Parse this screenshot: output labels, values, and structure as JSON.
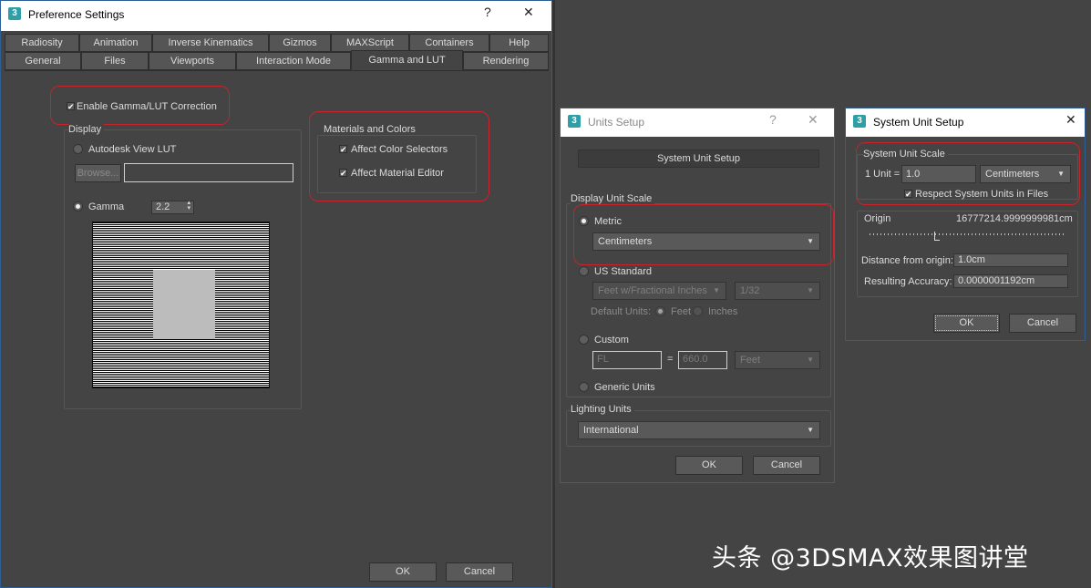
{
  "pref": {
    "title": "Preference Settings",
    "help_btn": "?",
    "close_btn": "✕",
    "logo": "3",
    "tabs_row1": [
      "Radiosity",
      "Animation",
      "Inverse Kinematics",
      "Gizmos",
      "MAXScript",
      "Containers",
      "Help"
    ],
    "tabs_row2": [
      "General",
      "Files",
      "Viewports",
      "Interaction Mode",
      "Gamma and LUT",
      "Rendering"
    ],
    "active_tab": "Gamma and LUT",
    "enable_gamma": "Enable Gamma/LUT Correction",
    "display_group": "Display",
    "autodesk_lut": "Autodesk View LUT",
    "browse_btn": "Browse...",
    "gamma_label": "Gamma",
    "gamma_value": "2.2",
    "materials_group": "Materials and Colors",
    "affect_color": "Affect Color Selectors",
    "affect_material": "Affect Material Editor",
    "ok": "OK",
    "cancel": "Cancel"
  },
  "units": {
    "title": "Units Setup",
    "help_btn": "?",
    "close_btn": "✕",
    "logo": "3",
    "system_unit_btn": "System Unit Setup",
    "display_scale": "Display Unit Scale",
    "metric": "Metric",
    "metric_value": "Centimeters",
    "us_standard": "US Standard",
    "us_value": "Feet w/Fractional Inches",
    "us_fraction": "1/32",
    "default_units": "Default Units:",
    "feet": "Feet",
    "inches": "Inches",
    "custom": "Custom",
    "custom_name": "FL",
    "equals": "=",
    "custom_value": "660.0",
    "custom_unit": "Feet",
    "generic": "Generic Units",
    "lighting": "Lighting Units",
    "lighting_value": "International",
    "ok": "OK",
    "cancel": "Cancel"
  },
  "system": {
    "title": "System Unit Setup",
    "close_btn": "✕",
    "logo": "3",
    "scale_group": "System Unit Scale",
    "unit_label": "1 Unit =",
    "unit_value": "1.0",
    "unit_type": "Centimeters",
    "respect": "Respect System Units in Files",
    "origin": "Origin",
    "origin_value": "16777214.9999999981cm",
    "distance_label": "Distance from origin:",
    "distance_value": "1.0cm",
    "accuracy_label": "Resulting Accuracy:",
    "accuracy_value": "0.0000001192cm",
    "ok": "OK",
    "cancel": "Cancel"
  },
  "watermark": "头条 @3DSMAX效果图讲堂"
}
